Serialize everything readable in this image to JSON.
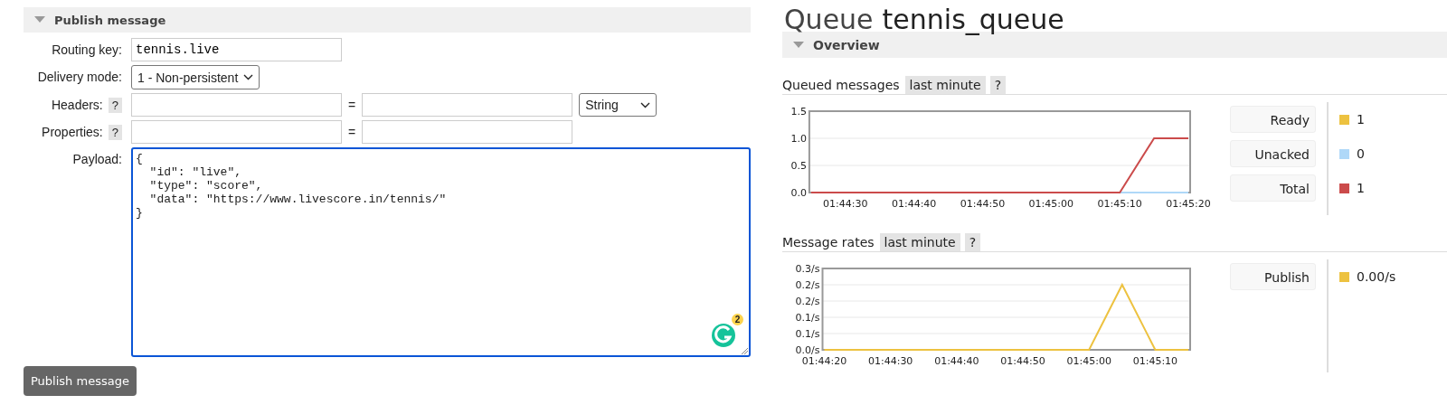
{
  "publish": {
    "title": "Publish message",
    "expanded": true,
    "fields": [
      {
        "kind": "text",
        "label": "Routing key:",
        "value": "tennis.live"
      },
      {
        "kind": "select",
        "label": "Delivery mode:",
        "value": "1 - Non-persistent"
      },
      {
        "kind": "pair",
        "label": "Headers:",
        "help": "?",
        "separator": "=",
        "type": "String"
      },
      {
        "kind": "pair",
        "label": "Properties:",
        "help": "?",
        "separator": "="
      },
      {
        "kind": "textarea",
        "label": "Payload:",
        "value": "{\n  \"id\": \"live\",\n  \"type\": \"score\",\n  \"data\": \"https://www.livescore.in/tennis/\"\n}",
        "focused": true,
        "badge": "2"
      }
    ],
    "button": "Publish message"
  },
  "queue": {
    "title_prefix": "Queue",
    "title_name": "tennis_queue",
    "section": {
      "title": "Overview",
      "expanded": true
    },
    "panels": [
      {
        "title": "Queued messages",
        "range": "last minute",
        "help": "?",
        "chart_data": {
          "type": "line",
          "categories": [
            null,
            "01:44:30",
            null,
            "01:44:40",
            null,
            "01:44:50",
            null,
            "01:45:00",
            null,
            "01:45:10",
            null,
            "01:45:20"
          ],
          "ylim": [
            0,
            1.5
          ],
          "grid": true,
          "yticks": [
            {
              "value": 0,
              "label": "0.0"
            },
            {
              "value": 0.5,
              "label": "0.5"
            },
            {
              "value": 1,
              "label": "1.0"
            },
            {
              "value": 1.5,
              "label": "1.5"
            }
          ],
          "series": [
            {
              "color": "#afd8f8",
              "values": [
                null,
                null,
                null,
                null,
                null,
                null,
                null,
                null,
                null,
                0,
                0,
                0
              ]
            },
            {
              "color": "#cb4b4b",
              "values": [
                0,
                0,
                0,
                0,
                0,
                0,
                0,
                0,
                0,
                0,
                1,
                1
              ]
            }
          ]
        },
        "legend": [
          {
            "label": "Ready",
            "color": "#edc240",
            "value": "1"
          },
          {
            "label": "Unacked",
            "color": "#afd8f8",
            "value": "0"
          },
          {
            "label": "Total",
            "color": "#cb4b4b",
            "value": "1"
          }
        ]
      },
      {
        "title": "Message rates",
        "range": "last minute",
        "help": "?",
        "chart_data": {
          "type": "line",
          "categories": [
            "01:44:20",
            null,
            "01:44:30",
            null,
            "01:44:40",
            null,
            "01:44:50",
            null,
            "01:45:00",
            null,
            "01:45:10",
            null
          ],
          "ylim": [
            0,
            0.25
          ],
          "grid": true,
          "yticks": [
            {
              "value": 0,
              "label": "0.0/s"
            },
            {
              "value": 0.05,
              "label": "0.1/s"
            },
            {
              "value": 0.1,
              "label": "0.1/s"
            },
            {
              "value": 0.15,
              "label": "0.2/s"
            },
            {
              "value": 0.2,
              "label": "0.2/s"
            },
            {
              "value": 0.25,
              "label": "0.3/s"
            }
          ],
          "series": [
            {
              "color": "#edc240",
              "values": [
                0,
                0,
                0,
                0,
                0,
                0,
                0,
                0,
                0,
                0.2,
                0,
                0
              ]
            }
          ]
        },
        "legend": [
          {
            "label": "Publish",
            "color": "#edc240",
            "value": "0.00/s"
          }
        ]
      }
    ]
  }
}
